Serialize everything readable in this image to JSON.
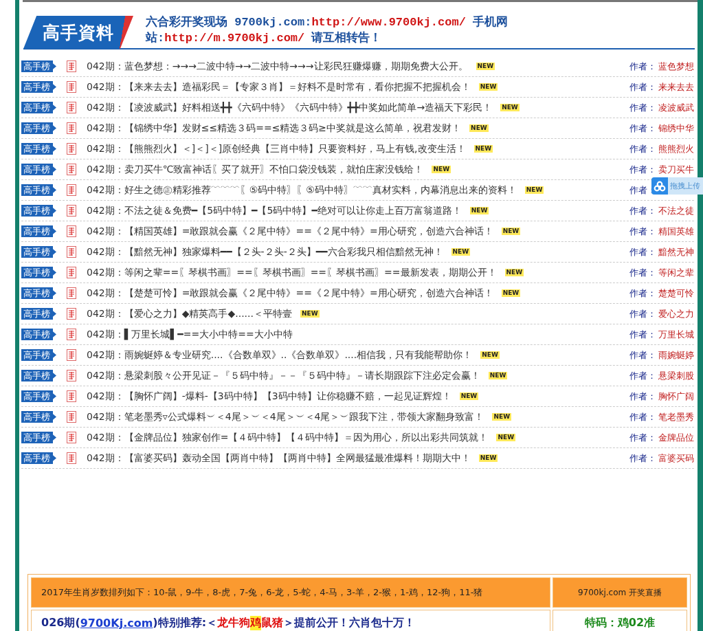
{
  "header": {
    "logo": "高手資料",
    "notice": [
      {
        "kind": "plain",
        "text": "六合彩开奖现场 9700kj.com:"
      },
      {
        "kind": "link",
        "text": "http://www.9700kj.com/"
      },
      {
        "kind": "plain",
        "text": " 手机网站:"
      },
      {
        "kind": "link",
        "text": "http://m.9700kj.com/"
      },
      {
        "kind": "plain",
        "text": " 请互相转告！"
      }
    ]
  },
  "posts": [
    {
      "badge": "高手榜",
      "title": "042期：蓝色梦想：→→→二波中特→→二波中特→→→让彩民狂赚爆赚，期期免费大公开。",
      "new": "NEW",
      "author_label": "作者：",
      "author": "蓝色梦想"
    },
    {
      "badge": "高手榜",
      "title": "042期：【来来去去】造福彩民＝【专家３肖】＝好料不是时常有，看你把握不把握机会！",
      "new": "NEW",
      "author_label": "作者：",
      "author": "来来去去"
    },
    {
      "badge": "高手榜",
      "title": "042期：【凌波威武】好料相送╋╋《六码中特》《六码中特》╋╋中奖如此简单→造福天下彩民！",
      "new": "NEW",
      "author_label": "作者：",
      "author": "凌波威武"
    },
    {
      "badge": "高手榜",
      "title": "042期：【锦绣中华】发财≤≤精选３码==≤精选３码≥中奖就是这么简单，祝君发财！",
      "new": "NEW",
      "author_label": "作者：",
      "author": "锦绣中华"
    },
    {
      "badge": "高手榜",
      "title": "042期：【熊熊烈火】＜]＜]＜]原创经典【三肖中特】只要资料好，马上有钱,改变生活！",
      "new": "NEW",
      "author_label": "作者：",
      "author": "熊熊烈火"
    },
    {
      "badge": "高手榜",
      "title": "042期：卖刀买牛℃致富神话〖买了就开〗不怕口袋没钱装，就怕庄家没钱给！",
      "new": "NEW",
      "author_label": "作者：",
      "author": "卖刀买牛"
    },
    {
      "badge": "高手榜",
      "title": "042期：好生之德㊣精彩推荐﹋﹋﹋〖⑤码中特〗〖⑤码中特〗﹋﹋真材实料，内幕消息出来的资料！",
      "new": "NEW",
      "author_label": "作者："
    },
    {
      "badge": "高手榜",
      "title": "042期：不法之徒＆免费━【5码中特】━【5码中特】━绝对可以让你走上百万富翁道路！",
      "new": "NEW",
      "author_label": "作者：",
      "author": "不法之徒"
    },
    {
      "badge": "高手榜",
      "title": "042期：【精国英雄】=敢跟就会赢《２尾中特》==《２尾中特》=用心研究，创造六合神话！",
      "new": "NEW",
      "author_label": "作者：",
      "author": "精国英雄"
    },
    {
      "badge": "高手榜",
      "title": "042期：【黯然无神】独家爆料━━【２头-２头-２头】━━六合彩我只相信黯然无神！",
      "new": "NEW",
      "author_label": "作者：",
      "author": "黯然无神"
    },
    {
      "badge": "高手榜",
      "title": "042期：等闲之辈==〖琴棋书画〗==〖琴棋书画〗==〖琴棋书画〗==最新发表，期期公开！",
      "new": "NEW",
      "author_label": "作者：",
      "author": "等闲之辈"
    },
    {
      "badge": "高手榜",
      "title": "042期：【楚楚可怜】=敢跟就会赢《２尾中特》==《２尾中特》=用心研究，创造六合神话！",
      "new": "NEW",
      "author_label": "作者：",
      "author": "楚楚可怜"
    },
    {
      "badge": "高手榜",
      "title": "042期：【爱心之力】◆精英高手◆......＜平特壹",
      "new": "NEW",
      "author_label": "作者：",
      "author": "爱心之力"
    },
    {
      "badge": "高手榜",
      "title": "042期：▌万里长城▌━==大小中特==大小中特",
      "author_label": "作者：",
      "author": "万里长城"
    },
    {
      "badge": "高手榜",
      "title": "042期：雨婉蜒婷＆专业研究....《合数单双》..《合数单双》....相信我，只有我能帮助你！",
      "new": "NEW",
      "author_label": "作者：",
      "author": "雨婉蜒婷"
    },
    {
      "badge": "高手榜",
      "title": "042期：悬梁刺股々公开见证－『５码中特』－－『５码中特』－请长期跟踪下注必定会赢！",
      "new": "NEW",
      "author_label": "作者：",
      "author": "悬梁刺股"
    },
    {
      "badge": "高手榜",
      "title": "042期：【胸怀广阔】-爆料-【3码中特】【3码中特】让你稳赚不赔，一起见证辉煌！",
      "new": "NEW",
      "author_label": "作者：",
      "author": "胸怀广阔"
    },
    {
      "badge": "高手榜",
      "title": "042期：笔老墨秀▿公式爆料︶＜4尾＞︶＜4尾＞︶＜4尾＞︶跟我下注，带领大家翻身致富！",
      "new": "NEW",
      "author_label": "作者：",
      "author": "笔老墨秀"
    },
    {
      "badge": "高手榜",
      "title": "042期：【金牌品位】独家创作=【４码中特】【４码中特】＝因为用心，所以出彩共同筑就！",
      "new": "NEW",
      "author_label": "作者：",
      "author": "金牌品位"
    },
    {
      "badge": "高手榜",
      "title": "042期：【富婆买码】轰动全国【两肖中特】【两肖中特】全网最猛最准爆料！期期大中！",
      "new": "NEW",
      "author_label": "作者：",
      "author": "富婆买码"
    }
  ],
  "upload_widget": {
    "label": "拖拽上传"
  },
  "zodiac_table": {
    "header": "2017年生肖岁数排列如下：10-鼠，9-牛，8-虎，7-兔，6-龙，5-蛇，4-马，3-羊，2-猴，1-鸡，12-狗，11-猪",
    "header_right": "9700kj.com 开奖直播",
    "pick": [
      {
        "kind": "plain",
        "text": "026期("
      },
      {
        "kind": "link",
        "text": "9700Kj.com"
      },
      {
        "kind": "plain",
        "text": ")特别推荐:＜ "
      },
      {
        "kind": "red",
        "text": "龙牛狗"
      },
      {
        "kind": "highlight",
        "text": "鸡"
      },
      {
        "kind": "red",
        "text": "鼠猪"
      },
      {
        "kind": "plain",
        "text": " ＞提前公开！六肖包十万！"
      }
    ],
    "pick_right": "特码：鸡02准"
  }
}
